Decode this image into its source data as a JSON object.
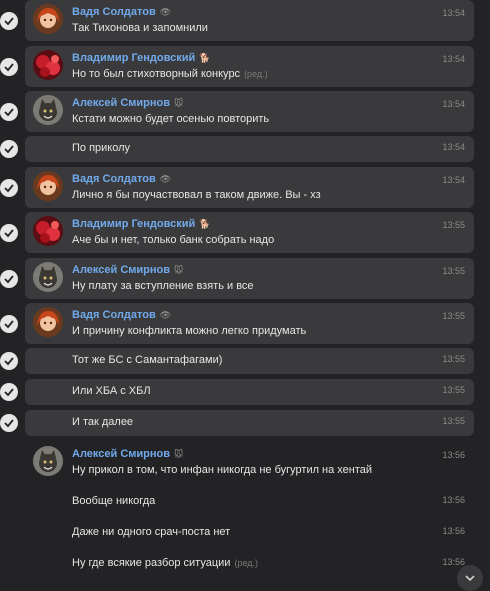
{
  "chat": {
    "messages": [
      {
        "author": "Вадя Солдатов",
        "badge": "eye-icon",
        "text": "Так Тихонова и запомнили",
        "time": "13:54",
        "selected": true,
        "avatar": "red-hair-girl"
      },
      {
        "author": "Владимир Гендовский",
        "badge": "dog-emoji",
        "text": "Но то был стихотворный конкурс",
        "edited": "(ред.)",
        "time": "13:54",
        "selected": true,
        "avatar": "red-flower"
      },
      {
        "author": "Алексей Смирнов",
        "badge": "mouse-emoji",
        "text": "Кстати можно будет осенью повторить",
        "time": "13:54",
        "selected": true,
        "avatar": "cat"
      },
      {
        "text": "По приколу",
        "time": "13:54",
        "selected": true
      },
      {
        "author": "Вадя Солдатов",
        "badge": "eye-icon",
        "text": "Лично я бы поучаствовал в таком движе. Вы - хз",
        "time": "13:54",
        "selected": true,
        "avatar": "red-hair-girl"
      },
      {
        "author": "Владимир Гендовский",
        "badge": "dog-emoji",
        "text": "Аче бы и нет, только банк собрать надо",
        "time": "13:55",
        "selected": true,
        "avatar": "red-flower"
      },
      {
        "author": "Алексей Смирнов",
        "badge": "mouse-emoji",
        "text": "Ну плату за вступление взять и все",
        "time": "13:55",
        "selected": true,
        "avatar": "cat"
      },
      {
        "author": "Вадя Солдатов",
        "badge": "eye-icon",
        "text": "И причину конфликта можно легко придумать",
        "time": "13:55",
        "selected": true,
        "avatar": "red-hair-girl"
      },
      {
        "text": "Тот же БС с Самантафагами)",
        "time": "13:55",
        "selected": true
      },
      {
        "text": "Или ХБА с ХБЛ",
        "time": "13:55",
        "selected": true
      },
      {
        "text": "И так далее",
        "time": "13:55",
        "selected": true
      },
      {
        "author": "Алексей Смирнов",
        "badge": "mouse-emoji",
        "text": "Ну прикол в том, что инфан никогда не бугуртил на хентай",
        "time": "13:56",
        "selected": false,
        "avatar": "cat"
      },
      {
        "text": "Вообще никогда",
        "time": "13:56",
        "selected": false
      },
      {
        "text": "Даже ни одного срач-поста нет",
        "time": "13:56",
        "selected": false
      },
      {
        "text": "Ну где всякие разбор ситуации",
        "edited": "(ред.)",
        "time": "13:56",
        "selected": false
      }
    ]
  },
  "colors": {
    "author": "#71aaeb",
    "background": "#232326",
    "selected": "#3a3a3c"
  }
}
